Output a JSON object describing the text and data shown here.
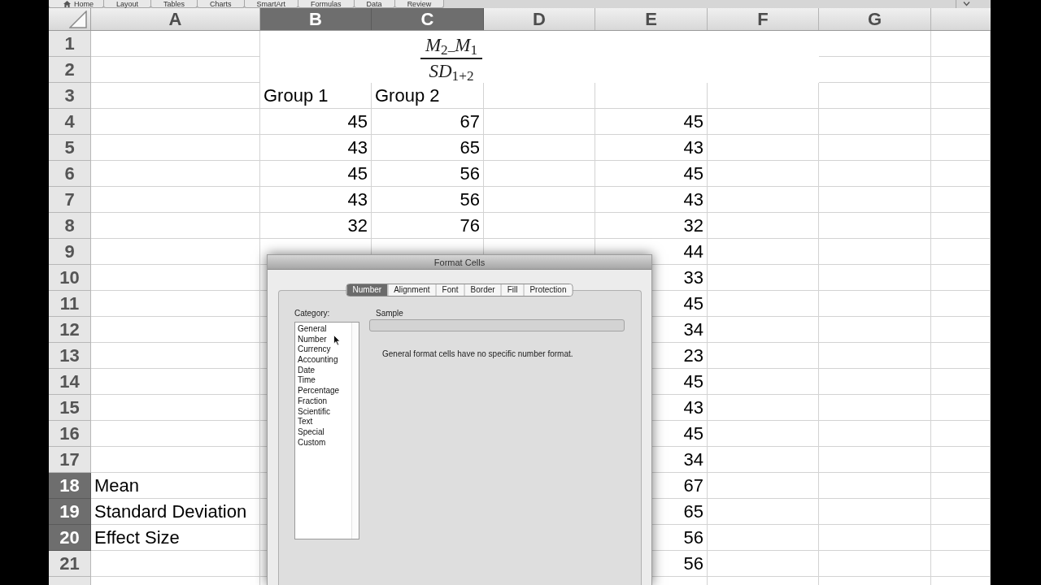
{
  "ribbon": {
    "tabs": [
      {
        "label": "Home",
        "kind": "with_icon"
      },
      {
        "label": "Layout",
        "kind": "plain"
      },
      {
        "label": "Tables",
        "kind": "plain"
      },
      {
        "label": "Charts",
        "kind": "plain"
      },
      {
        "label": "SmartArt",
        "kind": "plain"
      },
      {
        "label": "Formulas",
        "kind": "plain"
      },
      {
        "label": "Data",
        "kind": "plain"
      },
      {
        "label": "Review",
        "kind": "plain"
      }
    ]
  },
  "sheet": {
    "columns": [
      {
        "label": "A",
        "selected": false
      },
      {
        "label": "B",
        "selected": true
      },
      {
        "label": "C",
        "selected": true
      },
      {
        "label": "D",
        "selected": false
      },
      {
        "label": "E",
        "selected": false
      },
      {
        "label": "F",
        "selected": false
      },
      {
        "label": "G",
        "selected": false
      }
    ],
    "equation": {
      "numerator": "*M*$_{2–}$*M*$_{1}$",
      "denominator": "*SD*$_{1+2}$"
    },
    "rows": [
      {
        "number": "1",
        "selected": false,
        "cells": [
          null,
          null,
          null,
          null,
          null,
          null,
          null
        ]
      },
      {
        "number": "2",
        "selected": false,
        "cells": [
          null,
          null,
          null,
          null,
          null,
          null,
          null
        ]
      },
      {
        "number": "3",
        "selected": false,
        "cells": [
          null,
          {
            "text": "Group 1",
            "kind": "text"
          },
          {
            "text": "Group 2",
            "kind": "text"
          },
          null,
          null,
          null,
          null
        ]
      },
      {
        "number": "4",
        "selected": false,
        "cells": [
          null,
          {
            "text": "45",
            "kind": "number"
          },
          {
            "text": "67",
            "kind": "number"
          },
          null,
          {
            "text": "45",
            "kind": "number"
          },
          null,
          null
        ]
      },
      {
        "number": "5",
        "selected": false,
        "cells": [
          null,
          {
            "text": "43",
            "kind": "number"
          },
          {
            "text": "65",
            "kind": "number"
          },
          null,
          {
            "text": "43",
            "kind": "number"
          },
          null,
          null
        ]
      },
      {
        "number": "6",
        "selected": false,
        "cells": [
          null,
          {
            "text": "45",
            "kind": "number"
          },
          {
            "text": "56",
            "kind": "number"
          },
          null,
          {
            "text": "45",
            "kind": "number"
          },
          null,
          null
        ]
      },
      {
        "number": "7",
        "selected": false,
        "cells": [
          null,
          {
            "text": "43",
            "kind": "number"
          },
          {
            "text": "56",
            "kind": "number"
          },
          null,
          {
            "text": "43",
            "kind": "number"
          },
          null,
          null
        ]
      },
      {
        "number": "8",
        "selected": false,
        "cells": [
          null,
          {
            "text": "32",
            "kind": "number"
          },
          {
            "text": "76",
            "kind": "number"
          },
          null,
          {
            "text": "32",
            "kind": "number"
          },
          null,
          null
        ]
      },
      {
        "number": "9",
        "selected": false,
        "cells": [
          null,
          null,
          null,
          null,
          {
            "text": "44",
            "kind": "number"
          },
          null,
          null
        ]
      },
      {
        "number": "10",
        "selected": false,
        "cells": [
          null,
          null,
          null,
          null,
          {
            "text": "33",
            "kind": "number"
          },
          null,
          null
        ]
      },
      {
        "number": "11",
        "selected": false,
        "cells": [
          null,
          null,
          null,
          null,
          {
            "text": "45",
            "kind": "number"
          },
          null,
          null
        ]
      },
      {
        "number": "12",
        "selected": false,
        "cells": [
          null,
          null,
          null,
          null,
          {
            "text": "34",
            "kind": "number"
          },
          null,
          null
        ]
      },
      {
        "number": "13",
        "selected": false,
        "cells": [
          null,
          null,
          null,
          null,
          {
            "text": "23",
            "kind": "number"
          },
          null,
          null
        ]
      },
      {
        "number": "14",
        "selected": false,
        "cells": [
          null,
          null,
          null,
          null,
          {
            "text": "45",
            "kind": "number"
          },
          null,
          null
        ]
      },
      {
        "number": "15",
        "selected": false,
        "cells": [
          null,
          null,
          null,
          null,
          {
            "text": "43",
            "kind": "number"
          },
          null,
          null
        ]
      },
      {
        "number": "16",
        "selected": false,
        "cells": [
          null,
          null,
          null,
          null,
          {
            "text": "45",
            "kind": "number"
          },
          null,
          null
        ]
      },
      {
        "number": "17",
        "selected": false,
        "cells": [
          null,
          null,
          null,
          null,
          {
            "text": "34",
            "kind": "number"
          },
          null,
          null
        ]
      },
      {
        "number": "18",
        "selected": true,
        "cells": [
          {
            "text": "Mean",
            "kind": "text"
          },
          null,
          null,
          null,
          {
            "text": "67",
            "kind": "number"
          },
          null,
          null
        ]
      },
      {
        "number": "19",
        "selected": true,
        "cells": [
          {
            "text": "Standard Deviation",
            "kind": "text"
          },
          null,
          null,
          null,
          {
            "text": "65",
            "kind": "number"
          },
          null,
          null
        ]
      },
      {
        "number": "20",
        "selected": true,
        "cells": [
          {
            "text": "Effect Size",
            "kind": "text"
          },
          null,
          null,
          null,
          {
            "text": "56",
            "kind": "number"
          },
          null,
          null
        ]
      },
      {
        "number": "21",
        "selected": false,
        "cells": [
          null,
          null,
          null,
          null,
          {
            "text": "56",
            "kind": "number"
          },
          null,
          null
        ]
      }
    ]
  },
  "dialog": {
    "title": "Format Cells",
    "tabs": [
      {
        "label": "Number",
        "selected": true
      },
      {
        "label": "Alignment",
        "selected": false
      },
      {
        "label": "Font",
        "selected": false
      },
      {
        "label": "Border",
        "selected": false
      },
      {
        "label": "Fill",
        "selected": false
      },
      {
        "label": "Protection",
        "selected": false
      }
    ],
    "category_label": "Category:",
    "categories": [
      {
        "label": "General",
        "selected": false
      },
      {
        "label": "Number",
        "selected": false
      },
      {
        "label": "Currency",
        "selected": false
      },
      {
        "label": "Accounting",
        "selected": false
      },
      {
        "label": "Date",
        "selected": false
      },
      {
        "label": "Time",
        "selected": false
      },
      {
        "label": "Percentage",
        "selected": false
      },
      {
        "label": "Fraction",
        "selected": false
      },
      {
        "label": "Scientific",
        "selected": false
      },
      {
        "label": "Text",
        "selected": false
      },
      {
        "label": "Special",
        "selected": false
      },
      {
        "label": "Custom",
        "selected": false
      }
    ],
    "sample_label": "Sample",
    "description": "General format cells have no specific number format."
  }
}
